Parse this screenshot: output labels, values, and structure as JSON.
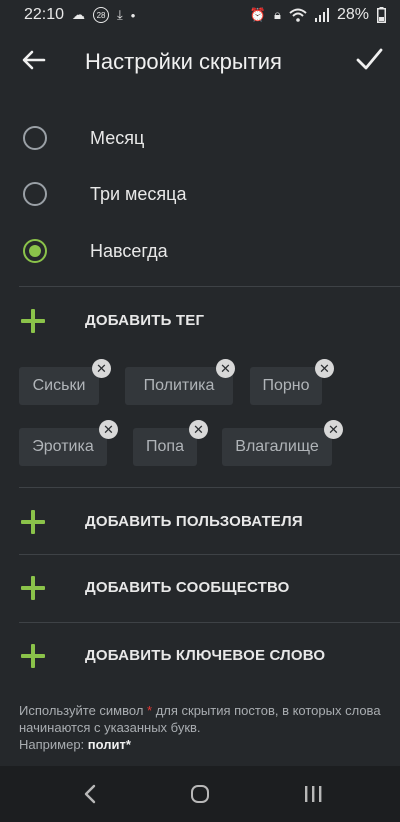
{
  "status": {
    "time": "22:10",
    "badge": "28",
    "battery": "28%"
  },
  "appbar": {
    "title": "Настройки скрытия"
  },
  "period": {
    "options": [
      {
        "label": "Месяц",
        "selected": false
      },
      {
        "label": "Три месяца",
        "selected": false
      },
      {
        "label": "Навсегда",
        "selected": true
      }
    ]
  },
  "tags": {
    "add_label": "ДОБАВИТЬ ТЕГ",
    "items": [
      "Сиськи",
      "Политика",
      "Порно",
      "Эротика",
      "Попа",
      "Влагалище"
    ]
  },
  "users": {
    "add_label": "ДОБАВИТЬ ПОЛЬЗОВАТЕЛЯ"
  },
  "communities": {
    "add_label": "ДОБАВИТЬ СООБЩЕСТВО"
  },
  "keywords": {
    "add_label": "ДОБАВИТЬ КЛЮЧЕВОЕ СЛОВО"
  },
  "hint": {
    "before_star": "Используйте символ ",
    "star": "*",
    "after_star": " для скрытия постов, в которых слова начинаются с указанных букв.",
    "example_prefix": "Например: ",
    "example": "полит*"
  },
  "colors": {
    "accent": "#8bc34a",
    "background": "#25282b",
    "chip": "#33373b",
    "star": "#e53935"
  }
}
